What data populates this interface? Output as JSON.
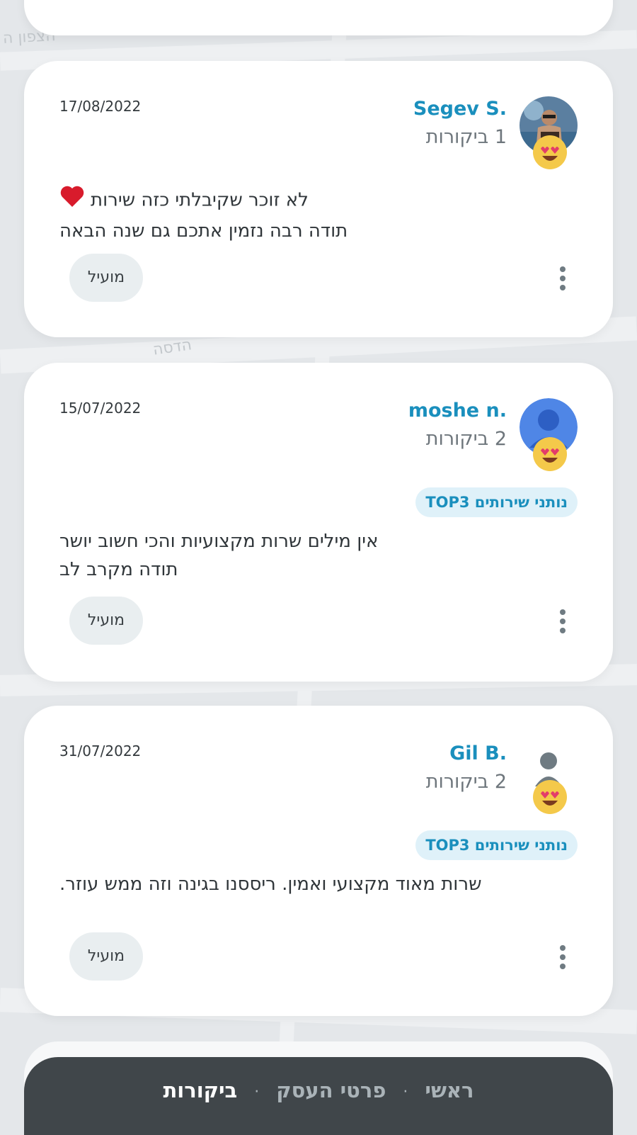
{
  "reviews": [
    {
      "name": "Segev S.",
      "review_count": "1 ביקורות",
      "date": "17/08/2022",
      "badge": "",
      "text_lines": [
        "לא זוכר שקיבלתי כזה שירות",
        "תודה רבה נזמין אתכם גם שנה הבאה"
      ],
      "has_heart": true,
      "helpful_label": "מועיל",
      "avatar_icon": "photo-avatar",
      "emoji_icon": "heart-eyes-emoji"
    },
    {
      "name": "moshe n.",
      "review_count": "2 ביקורות",
      "date": "15/07/2022",
      "badge": "נותני שירותים TOP3",
      "text_lines": [
        "אין מילים שרות מקצועיות  והכי חשוב יושר",
        "תודה מקרב לב"
      ],
      "has_heart": false,
      "helpful_label": "מועיל",
      "avatar_icon": "default-user-avatar",
      "emoji_icon": "heart-eyes-emoji"
    },
    {
      "name": "Gil B.",
      "review_count": "2 ביקורות",
      "date": "31/07/2022",
      "badge": "נותני שירותים TOP3",
      "text_lines": [
        "שרות מאוד מקצועי ואמין. ריססנו בגינה וזה ממש עוזר."
      ],
      "has_heart": false,
      "helpful_label": "מועיל",
      "avatar_icon": "user-silhouette-icon",
      "emoji_icon": "heart-eyes-emoji"
    }
  ],
  "map_labels": [
    "הצפון ה",
    "הדסה"
  ],
  "bottom_nav": {
    "items": [
      "ראשי",
      "פרטי העסק",
      "ביקורות"
    ],
    "active": "ביקורות",
    "separator": "·"
  },
  "colors": {
    "accent": "#1a8fbd",
    "badge_bg": "#dff1f9",
    "nav_bg": "#40464a"
  }
}
